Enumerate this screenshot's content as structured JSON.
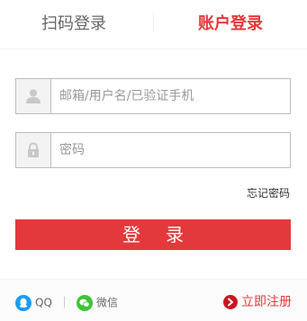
{
  "tabs": {
    "qr_login": "扫码登录",
    "account_login": "账户登录",
    "active": "account_login"
  },
  "username": {
    "placeholder": "邮箱/用户名/已验证手机",
    "value": "",
    "icon": "user-icon"
  },
  "password": {
    "placeholder": "密码",
    "value": "",
    "icon": "lock-icon"
  },
  "forgot_password": "忘记密码",
  "login_button": "登录",
  "footer": {
    "qq_label": "QQ",
    "wechat_label": "微信",
    "register_label": "立即注册"
  },
  "colors": {
    "accent": "#e4393c",
    "qq": "#1a9cf7",
    "wechat": "#3fc337",
    "register_icon": "#c81623"
  }
}
